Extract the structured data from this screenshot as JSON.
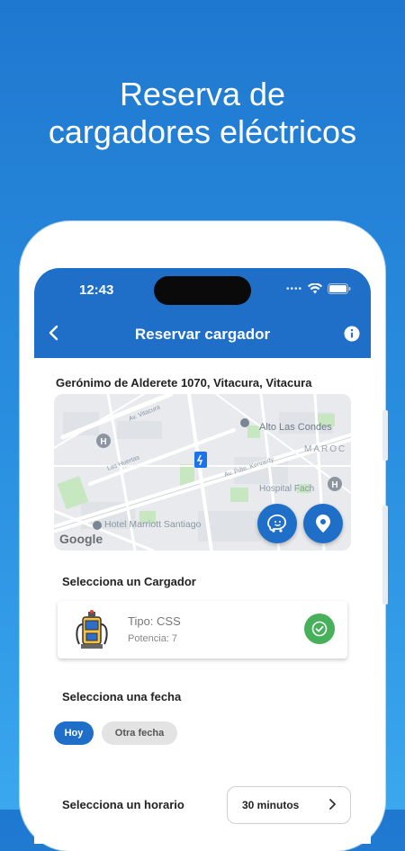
{
  "headline": {
    "line1": "Reserva de",
    "line2": "cargadores eléctricos"
  },
  "status_bar": {
    "time": "12:43",
    "icons": [
      "signal-dots-icon",
      "wifi-icon",
      "battery-icon"
    ]
  },
  "nav": {
    "back_icon": "chevron-left-icon",
    "title": "Reservar cargador",
    "info_icon": "info-icon"
  },
  "location": {
    "address": "Gerónimo de Alderete 1070, Vitacura, Vitacura"
  },
  "map": {
    "labels": {
      "alto": "Alto Las Condes",
      "maroc": "MAROC",
      "hospital": "Hospital Fach",
      "hotel": "Hotel Marriott Santiago",
      "street_kennedy": "Av. Pdte. Kennedy",
      "street_huertas": "Las Huertas",
      "street_vitacura": "Av. Vitacura",
      "google": "Google"
    },
    "fab_icons": [
      "waze-icon",
      "location-pin-icon"
    ]
  },
  "charger_section": {
    "title": "Selecciona un Cargador",
    "charger": {
      "type": "Tipo: CSS",
      "power": "Potencia: 7",
      "selected": true
    }
  },
  "date_section": {
    "title": "Selecciona una fecha",
    "chips": {
      "today": "Hoy",
      "other": "Otra fecha"
    },
    "selected": "Hoy"
  },
  "time_section": {
    "title": "Selecciona un horario",
    "duration": "30 minutos"
  },
  "colors": {
    "primary": "#1f6fc9",
    "success": "#46b05a",
    "background_top": "#1f78cf",
    "background_bottom": "#3aa7ee"
  }
}
